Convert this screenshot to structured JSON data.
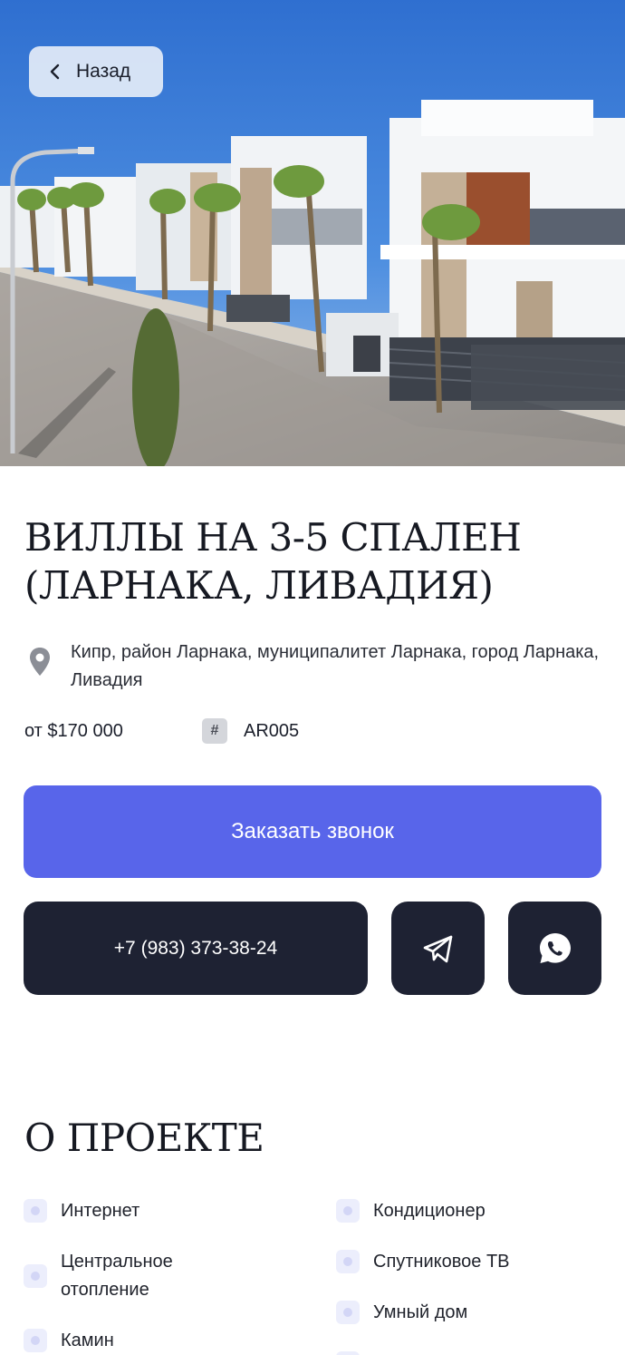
{
  "header": {
    "back_label": "Назад"
  },
  "listing": {
    "title": "ВИЛЛЫ НА 3-5 СПАЛЕН (ЛАРНАКА, ЛИВАДИЯ)",
    "address": "Кипр, район Ларнака, муниципалитет Ларнака, город Ларнака, Ливадия",
    "price": "от $170 000",
    "code": "AR005"
  },
  "actions": {
    "call_label": "Заказать звонок",
    "phone": "+7 (983) 373-38-24"
  },
  "about": {
    "title": "О ПРОЕКТЕ",
    "left_features": [
      "Интернет",
      "Центральное отопление",
      "Камин"
    ],
    "right_features": [
      "Кондиционер",
      "Спутниковое ТВ",
      "Умный дом",
      ""
    ]
  },
  "icons": {
    "back": "chevron-left-icon",
    "location": "map-pin-icon",
    "code": "hash-icon",
    "telegram": "telegram-icon",
    "whatsapp": "whatsapp-icon"
  },
  "colors": {
    "accent": "#5865ea",
    "dark_button": "#1e2233",
    "feature_bullet": "#eceefc"
  }
}
